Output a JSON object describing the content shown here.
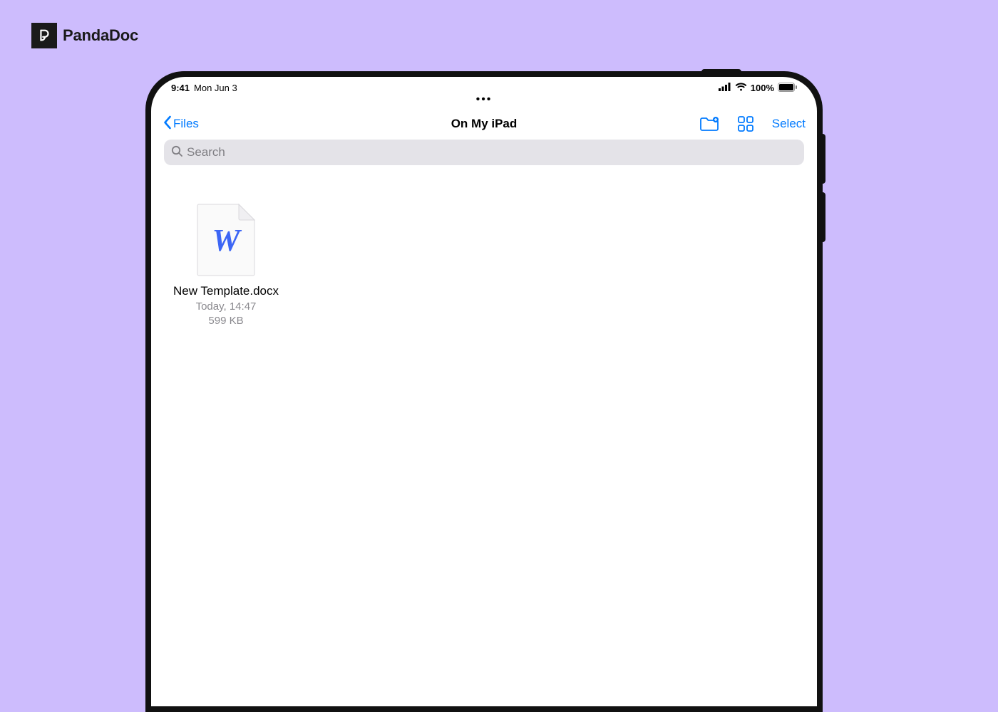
{
  "brand": {
    "name": "PandaDoc"
  },
  "statusbar": {
    "time": "9:41",
    "date": "Mon Jun 3",
    "battery": "100%"
  },
  "nav": {
    "back_label": "Files",
    "title": "On My iPad",
    "select_label": "Select"
  },
  "search": {
    "placeholder": "Search"
  },
  "files": [
    {
      "name": "New Template.docx",
      "modified": "Today, 14:47",
      "size": "599 KB"
    }
  ]
}
